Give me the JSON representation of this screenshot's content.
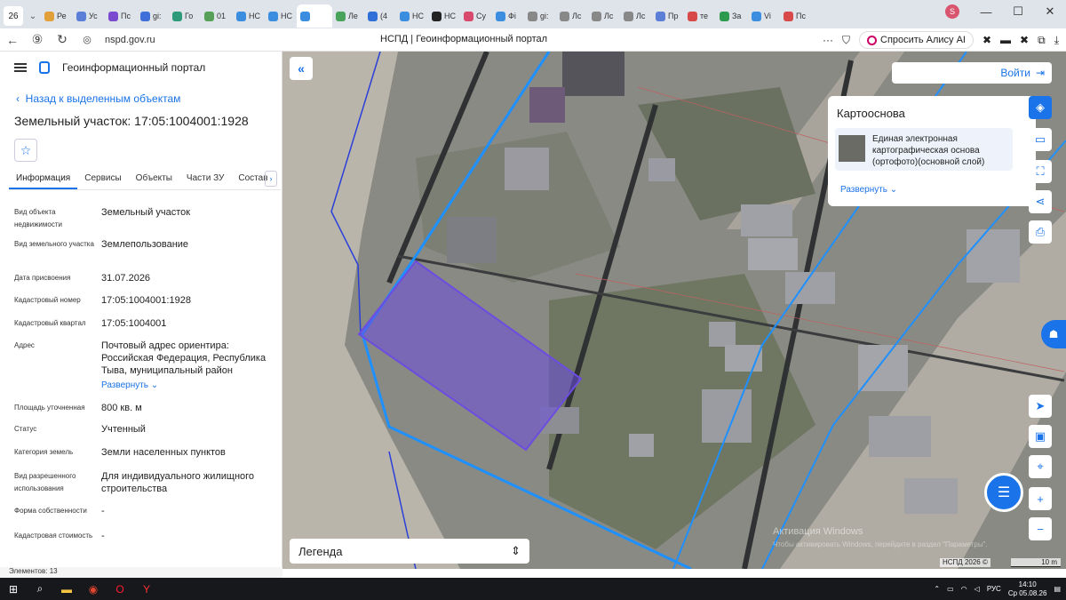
{
  "browser": {
    "tab_count": "26",
    "tabs": [
      "Ре",
      "Ус",
      "Пс",
      "gi:",
      "Го",
      "01",
      "НС",
      "НС",
      "",
      "Ле",
      "(4",
      "НС",
      "НС",
      "Су",
      "Фі",
      "gi:",
      "Лс",
      "Лс",
      "Лс",
      "Пр",
      "те",
      "За",
      "Vi",
      "Пс"
    ],
    "url": "nspd.gov.ru",
    "page_title": "НСПД | Геоинформационный портал",
    "alice_label": "Спросить Алису AI",
    "profile_letter": "S"
  },
  "panel": {
    "portal_name": "Геоинформационный портал",
    "back_link": "Назад к выделенным объектам",
    "title": "Земельный участок: 17:05:1004001:1928",
    "tabs": [
      "Информация",
      "Сервисы",
      "Объекты",
      "Части ЗУ",
      "Состав"
    ],
    "attributes": [
      {
        "k": "Вид объекта недвижимости",
        "v": "Земельный участок"
      },
      {
        "k": "Вид земельного участка",
        "v": "Землепользование"
      },
      {
        "k": "Дата присвоения",
        "v": "31.07.2026"
      },
      {
        "k": "Кадастровый номер",
        "v": "17:05:1004001:1928"
      },
      {
        "k": "Кадастровый квартал",
        "v": "17:05:1004001"
      },
      {
        "k": "Адрес",
        "v": "Почтовый адрес ориентира: Российская Федерация, Республика Тыва, муниципальный район"
      },
      {
        "k": "Площадь уточненная",
        "v": "800 кв. м"
      },
      {
        "k": "Статус",
        "v": "Учтенный"
      },
      {
        "k": "Категория земель",
        "v": "Земли населенных пунктов"
      },
      {
        "k": "Вид разрешенного использования",
        "v": "Для индивидуального жилищного строительства"
      },
      {
        "k": "Форма собственности",
        "v": "-"
      },
      {
        "k": "Кадастровая стоимость",
        "v": "-"
      }
    ],
    "expand_label": "Развернуть",
    "status_bar": "Элементов: 13"
  },
  "map": {
    "login_label": "Войти",
    "basemap_title": "Картооснова",
    "layer_name": "Единая электронная картографическая основа (ортофото)(основной слой)",
    "expand_label": "Развернуть",
    "legend_label": "Легенда",
    "watermark_title": "Активация Windows",
    "watermark_sub": "Чтобы активировать Windows, перейдите в раздел \"Параметры\".",
    "attribution": "НСПД 2026 ©",
    "scale": "10 m",
    "colors": {
      "accent": "#1a73e8",
      "parcel": "#6c4de0"
    }
  },
  "taskbar": {
    "lang": "РУС",
    "time": "14:10",
    "date": "Ср 05.08.26"
  }
}
